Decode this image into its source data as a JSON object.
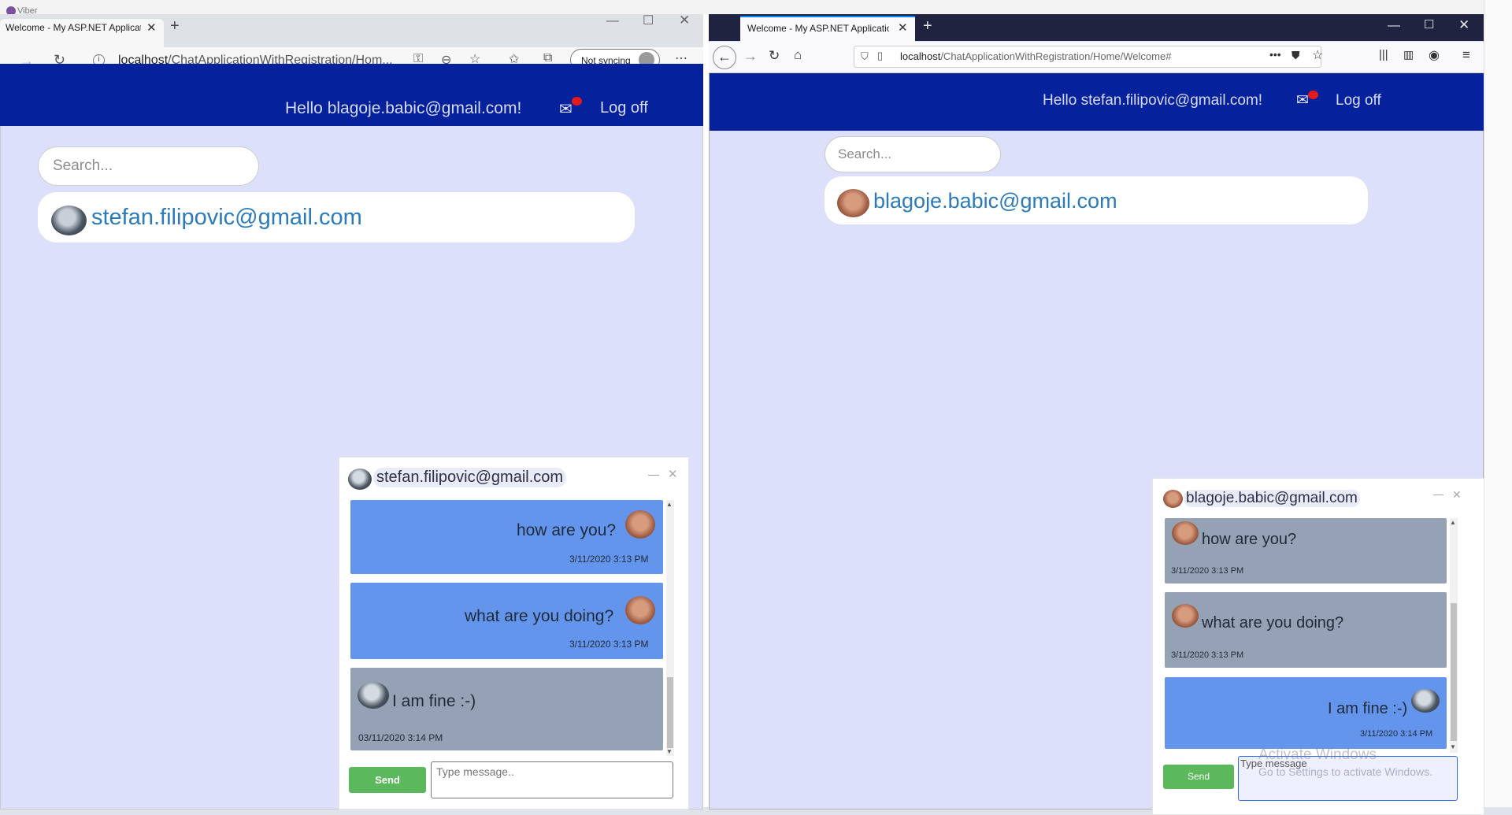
{
  "desktop": {
    "viber_title": "Viber"
  },
  "left_browser": {
    "tab_title": "Welcome - My ASP.NET Applicati",
    "url_host": "localhost",
    "url_path": "/ChatApplicationWithRegistration/Hom...",
    "sync_label": "Not syncing",
    "app": {
      "hello": "Hello blagoje.babic@gmail.com!",
      "logoff": "Log off",
      "search_placeholder": "Search...",
      "contact": "stefan.filipovic@gmail.com",
      "chat": {
        "title": "stefan.filipovic@gmail.com",
        "messages": [
          {
            "text": "how are you?",
            "time": "3/11/2020 3:13 PM",
            "side": "sent"
          },
          {
            "text": "what are you doing?",
            "time": "3/11/2020 3:13 PM",
            "side": "sent"
          },
          {
            "text": "I am fine :-)",
            "time": "03/11/2020 3:14 PM",
            "side": "received"
          }
        ],
        "send_label": "Send",
        "input_placeholder": "Type message.."
      }
    }
  },
  "right_browser": {
    "tab_title": "Welcome - My ASP.NET Applicatio",
    "url_host": "localhost",
    "url_path": "/ChatApplicationWithRegistration/Home/Welcome#",
    "app": {
      "hello": "Hello stefan.filipovic@gmail.com!",
      "logoff": "Log off",
      "search_placeholder": "Search...",
      "contact": "blagoje.babic@gmail.com",
      "chat": {
        "title": "blagoje.babic@gmail.com",
        "messages": [
          {
            "text": "how are you?",
            "time": "3/11/2020 3:13 PM",
            "side": "received"
          },
          {
            "text": "what are you doing?",
            "time": "3/11/2020 3:13 PM",
            "side": "received"
          },
          {
            "text": "I am fine :-)",
            "time": "3/11/2020 3:14 PM",
            "side": "sent"
          }
        ],
        "send_label": "Send",
        "input_placeholder": "Type message"
      }
    }
  },
  "watermark": {
    "title": "Activate Windows",
    "subtitle": "Go to Settings to activate Windows."
  },
  "colors": {
    "header_navy": "#05219b",
    "page_bg": "#dde0fb",
    "sent_bubble": "#6495ed",
    "received_bubble": "#95a2b6",
    "send_button": "#5cb85c",
    "link_blue": "#2c7bb9"
  },
  "icons": [
    "mail-icon",
    "notification-dot",
    "close-icon",
    "minimize-icon",
    "maximize-icon",
    "reload-icon",
    "back-icon",
    "forward-icon",
    "home-icon",
    "star-icon",
    "menu-icon"
  ]
}
